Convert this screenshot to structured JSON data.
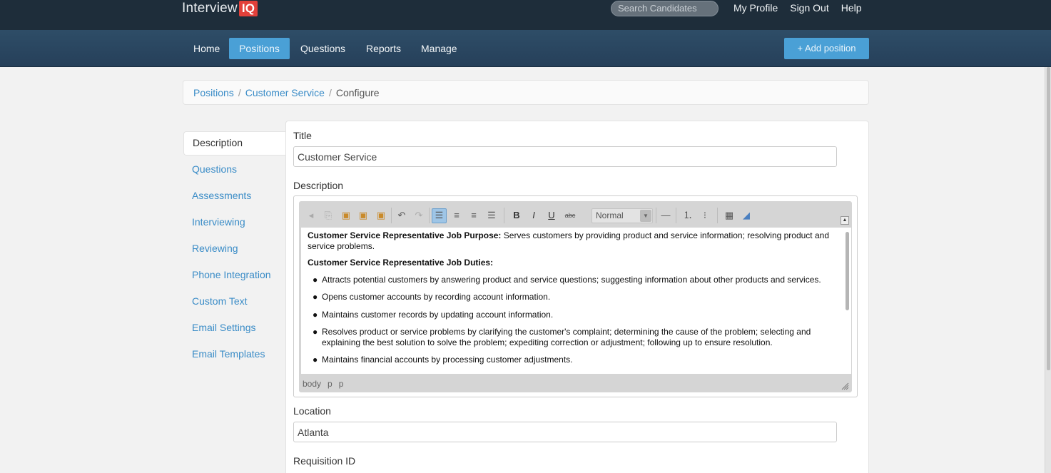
{
  "app": {
    "brand": "Interview",
    "brand_badge": "IQ"
  },
  "topbar": {
    "search_placeholder": "Search Candidates",
    "links": [
      "My Profile",
      "Sign Out",
      "Help"
    ]
  },
  "nav": {
    "items": [
      "Home",
      "Positions",
      "Questions",
      "Reports",
      "Manage"
    ],
    "active": "Positions",
    "add_button": "+ Add position"
  },
  "breadcrumb": {
    "items": [
      "Positions",
      "Customer Service"
    ],
    "current": "Configure",
    "separator": "/"
  },
  "sidetabs": {
    "items": [
      "Description",
      "Questions",
      "Assessments",
      "Interviewing",
      "Reviewing",
      "Phone Integration",
      "Custom Text",
      "Email Settings",
      "Email Templates"
    ],
    "active": "Description"
  },
  "form": {
    "title_label": "Title",
    "title_value": "Customer Service",
    "description_label": "Description",
    "location_label": "Location",
    "location_value": "Atlanta",
    "requisition_label": "Requisition ID"
  },
  "editor": {
    "format_select": "Normal",
    "toolbar_icons": [
      "back-icon",
      "copy-icon",
      "paste-icon",
      "paste-text-icon",
      "paste-word-icon",
      "undo-icon",
      "redo-icon",
      "align-left-icon",
      "align-center-icon",
      "align-right-icon",
      "align-justify-icon",
      "bold-icon",
      "italic-icon",
      "underline-icon",
      "strikethrough-icon",
      "horizontal-rule-icon",
      "numbered-list-icon",
      "bullet-list-icon",
      "select-all-icon",
      "remove-format-icon"
    ],
    "bold_glyph": "B",
    "italic_glyph": "I",
    "underline_glyph": "U",
    "strike_glyph": "abc",
    "purpose_heading": "Customer Service Representative Job Purpose:",
    "purpose_text": " Serves customers by providing product and service information; resolving product and service problems.",
    "duties_heading": "Customer Service Representative Job Duties:",
    "duties": [
      "Attracts potential customers by answering product and service questions; suggesting information about other products and services.",
      "Opens customer accounts by recording account information.",
      "Maintains customer records by updating account information.",
      "Resolves product or service problems by clarifying the customer's complaint; determining the cause of the problem; selecting and explaining the best solution to solve the problem; expediting correction or adjustment; following up to ensure resolution.",
      "Maintains financial accounts by processing customer adjustments."
    ],
    "status_path": [
      "body",
      "p",
      "p"
    ]
  },
  "colors": {
    "nav_active": "#4aa0d6",
    "brand_badge": "#e2403a",
    "link": "#3a8cc7"
  }
}
